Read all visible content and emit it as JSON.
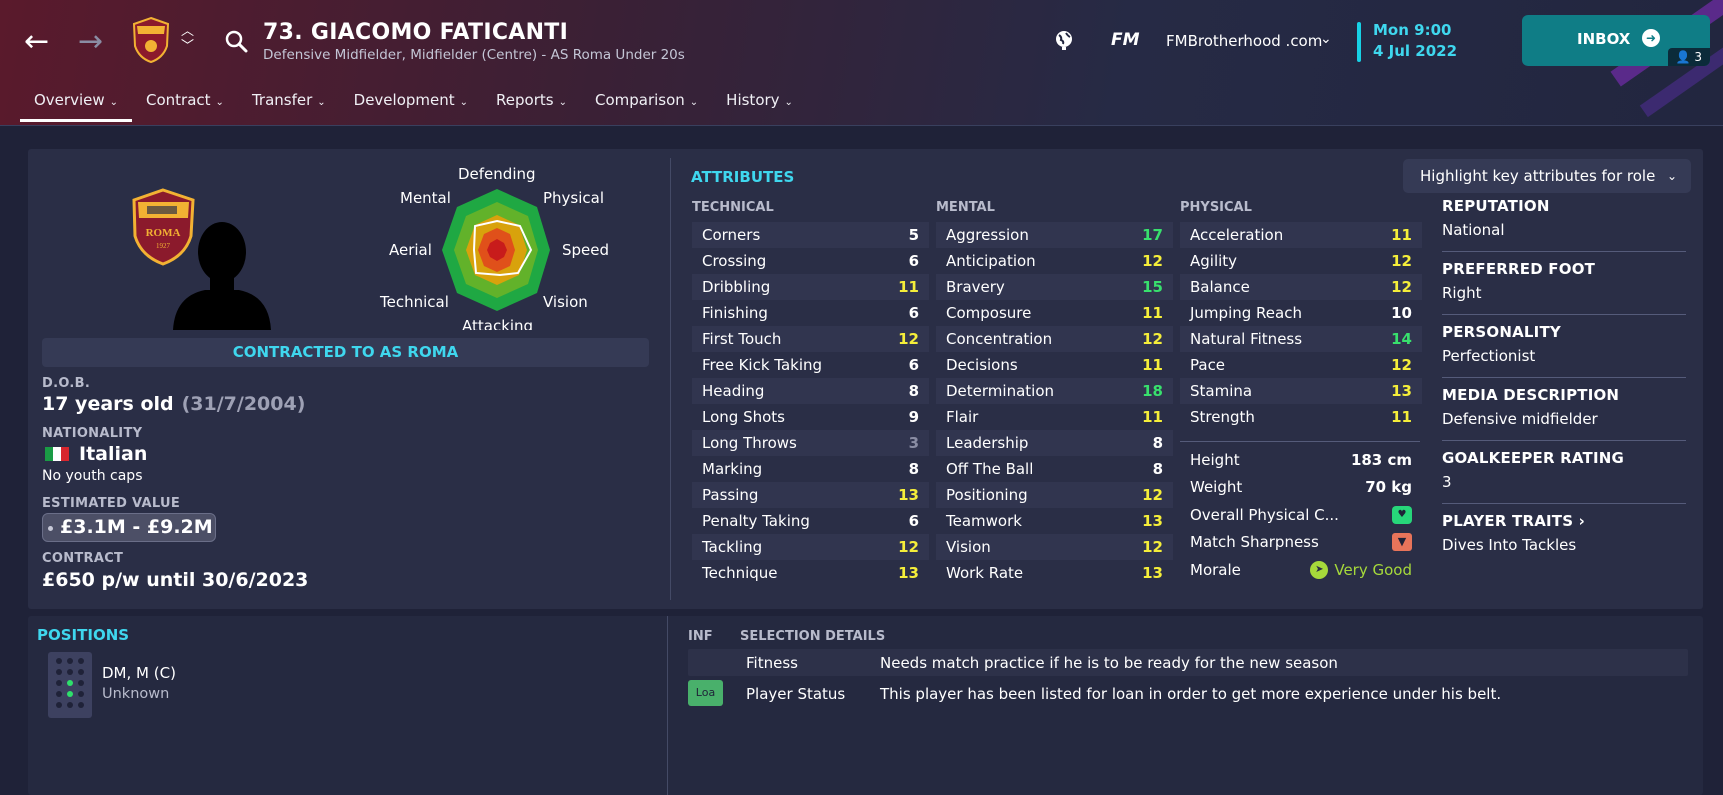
{
  "header": {
    "title": "73. GIACOMO FATICANTI",
    "subtitle": "Defensive Midfielder, Midfielder (Centre) - AS Roma Under 20s",
    "fm_logo": "FM",
    "site": "FMBrotherhood .com",
    "day_time": "Mon 9:00",
    "date": "4 Jul 2022",
    "inbox_label": "INBOX",
    "inbox_count": "3",
    "crest_text": "ROMA",
    "crest_year": "1927"
  },
  "tabs": [
    {
      "label": "Overview",
      "active": true
    },
    {
      "label": "Contract"
    },
    {
      "label": "Transfer"
    },
    {
      "label": "Development"
    },
    {
      "label": "Reports"
    },
    {
      "label": "Comparison"
    },
    {
      "label": "History"
    }
  ],
  "radar": {
    "labels": [
      "Defending",
      "Physical",
      "Speed",
      "Vision",
      "Attacking",
      "Technical",
      "Aerial",
      "Mental"
    ]
  },
  "overview": {
    "contracted": "CONTRACTED TO AS ROMA",
    "dob_label": "D.O.B.",
    "dob_age": "17 years old",
    "dob_date": "(31/7/2004)",
    "nationality_label": "NATIONALITY",
    "nationality": "Italian",
    "youth_caps": "No youth caps",
    "value_label": "ESTIMATED VALUE",
    "value": "£3.1M - £9.2M",
    "contract_label": "CONTRACT",
    "contract": "£650 p/w until 30/6/2023"
  },
  "attributes": {
    "title": "ATTRIBUTES",
    "highlight_button": "Highlight key attributes for role",
    "technical_label": "TECHNICAL",
    "mental_label": "MENTAL",
    "physical_label": "PHYSICAL",
    "technical": [
      {
        "name": "Corners",
        "value": "5"
      },
      {
        "name": "Crossing",
        "value": "6"
      },
      {
        "name": "Dribbling",
        "value": "11"
      },
      {
        "name": "Finishing",
        "value": "6"
      },
      {
        "name": "First Touch",
        "value": "12"
      },
      {
        "name": "Free Kick Taking",
        "value": "6"
      },
      {
        "name": "Heading",
        "value": "8"
      },
      {
        "name": "Long Shots",
        "value": "9"
      },
      {
        "name": "Long Throws",
        "value": "3"
      },
      {
        "name": "Marking",
        "value": "8"
      },
      {
        "name": "Passing",
        "value": "13"
      },
      {
        "name": "Penalty Taking",
        "value": "6"
      },
      {
        "name": "Tackling",
        "value": "12"
      },
      {
        "name": "Technique",
        "value": "13"
      }
    ],
    "mental": [
      {
        "name": "Aggression",
        "value": "17"
      },
      {
        "name": "Anticipation",
        "value": "12"
      },
      {
        "name": "Bravery",
        "value": "15"
      },
      {
        "name": "Composure",
        "value": "11"
      },
      {
        "name": "Concentration",
        "value": "12"
      },
      {
        "name": "Decisions",
        "value": "11"
      },
      {
        "name": "Determination",
        "value": "18"
      },
      {
        "name": "Flair",
        "value": "11"
      },
      {
        "name": "Leadership",
        "value": "8"
      },
      {
        "name": "Off The Ball",
        "value": "8"
      },
      {
        "name": "Positioning",
        "value": "12"
      },
      {
        "name": "Teamwork",
        "value": "13"
      },
      {
        "name": "Vision",
        "value": "12"
      },
      {
        "name": "Work Rate",
        "value": "13"
      }
    ],
    "physical": [
      {
        "name": "Acceleration",
        "value": "11"
      },
      {
        "name": "Agility",
        "value": "12"
      },
      {
        "name": "Balance",
        "value": "12"
      },
      {
        "name": "Jumping Reach",
        "value": "10"
      },
      {
        "name": "Natural Fitness",
        "value": "14"
      },
      {
        "name": "Pace",
        "value": "12"
      },
      {
        "name": "Stamina",
        "value": "13"
      },
      {
        "name": "Strength",
        "value": "11"
      }
    ],
    "height_label": "Height",
    "height": "183 cm",
    "weight_label": "Weight",
    "weight": "70 kg",
    "condition_label": "Overall Physical C...",
    "sharpness_label": "Match Sharpness",
    "morale_label": "Morale",
    "morale": "Very Good"
  },
  "info": {
    "reputation_label": "REPUTATION",
    "reputation": "National",
    "foot_label": "PREFERRED FOOT",
    "foot": "Right",
    "personality_label": "PERSONALITY",
    "personality": "Perfectionist",
    "media_label": "MEDIA DESCRIPTION",
    "media": "Defensive midfielder",
    "gk_label": "GOALKEEPER RATING",
    "gk": "3",
    "traits_label": "PLAYER TRAITS",
    "traits": "Dives Into Tackles"
  },
  "positions": {
    "title": "POSITIONS",
    "value": "DM, M (C)",
    "sub": "Unknown"
  },
  "selection": {
    "inf_label": "INF",
    "title": "SELECTION DETAILS",
    "rows": [
      {
        "name": "Fitness",
        "desc": "Needs match practice if he is to be ready for the new season"
      },
      {
        "name": "Player Status",
        "desc": "This player has been listed for loan in order to get more experience under his belt.",
        "badge": "Loa"
      }
    ]
  },
  "colors": {
    "accent": "#3fd7ee",
    "inbox": "#0f7d86",
    "attr_high": "#38e06d",
    "attr_good": "#f5ee3a",
    "attr_low": "#8a8da4"
  }
}
